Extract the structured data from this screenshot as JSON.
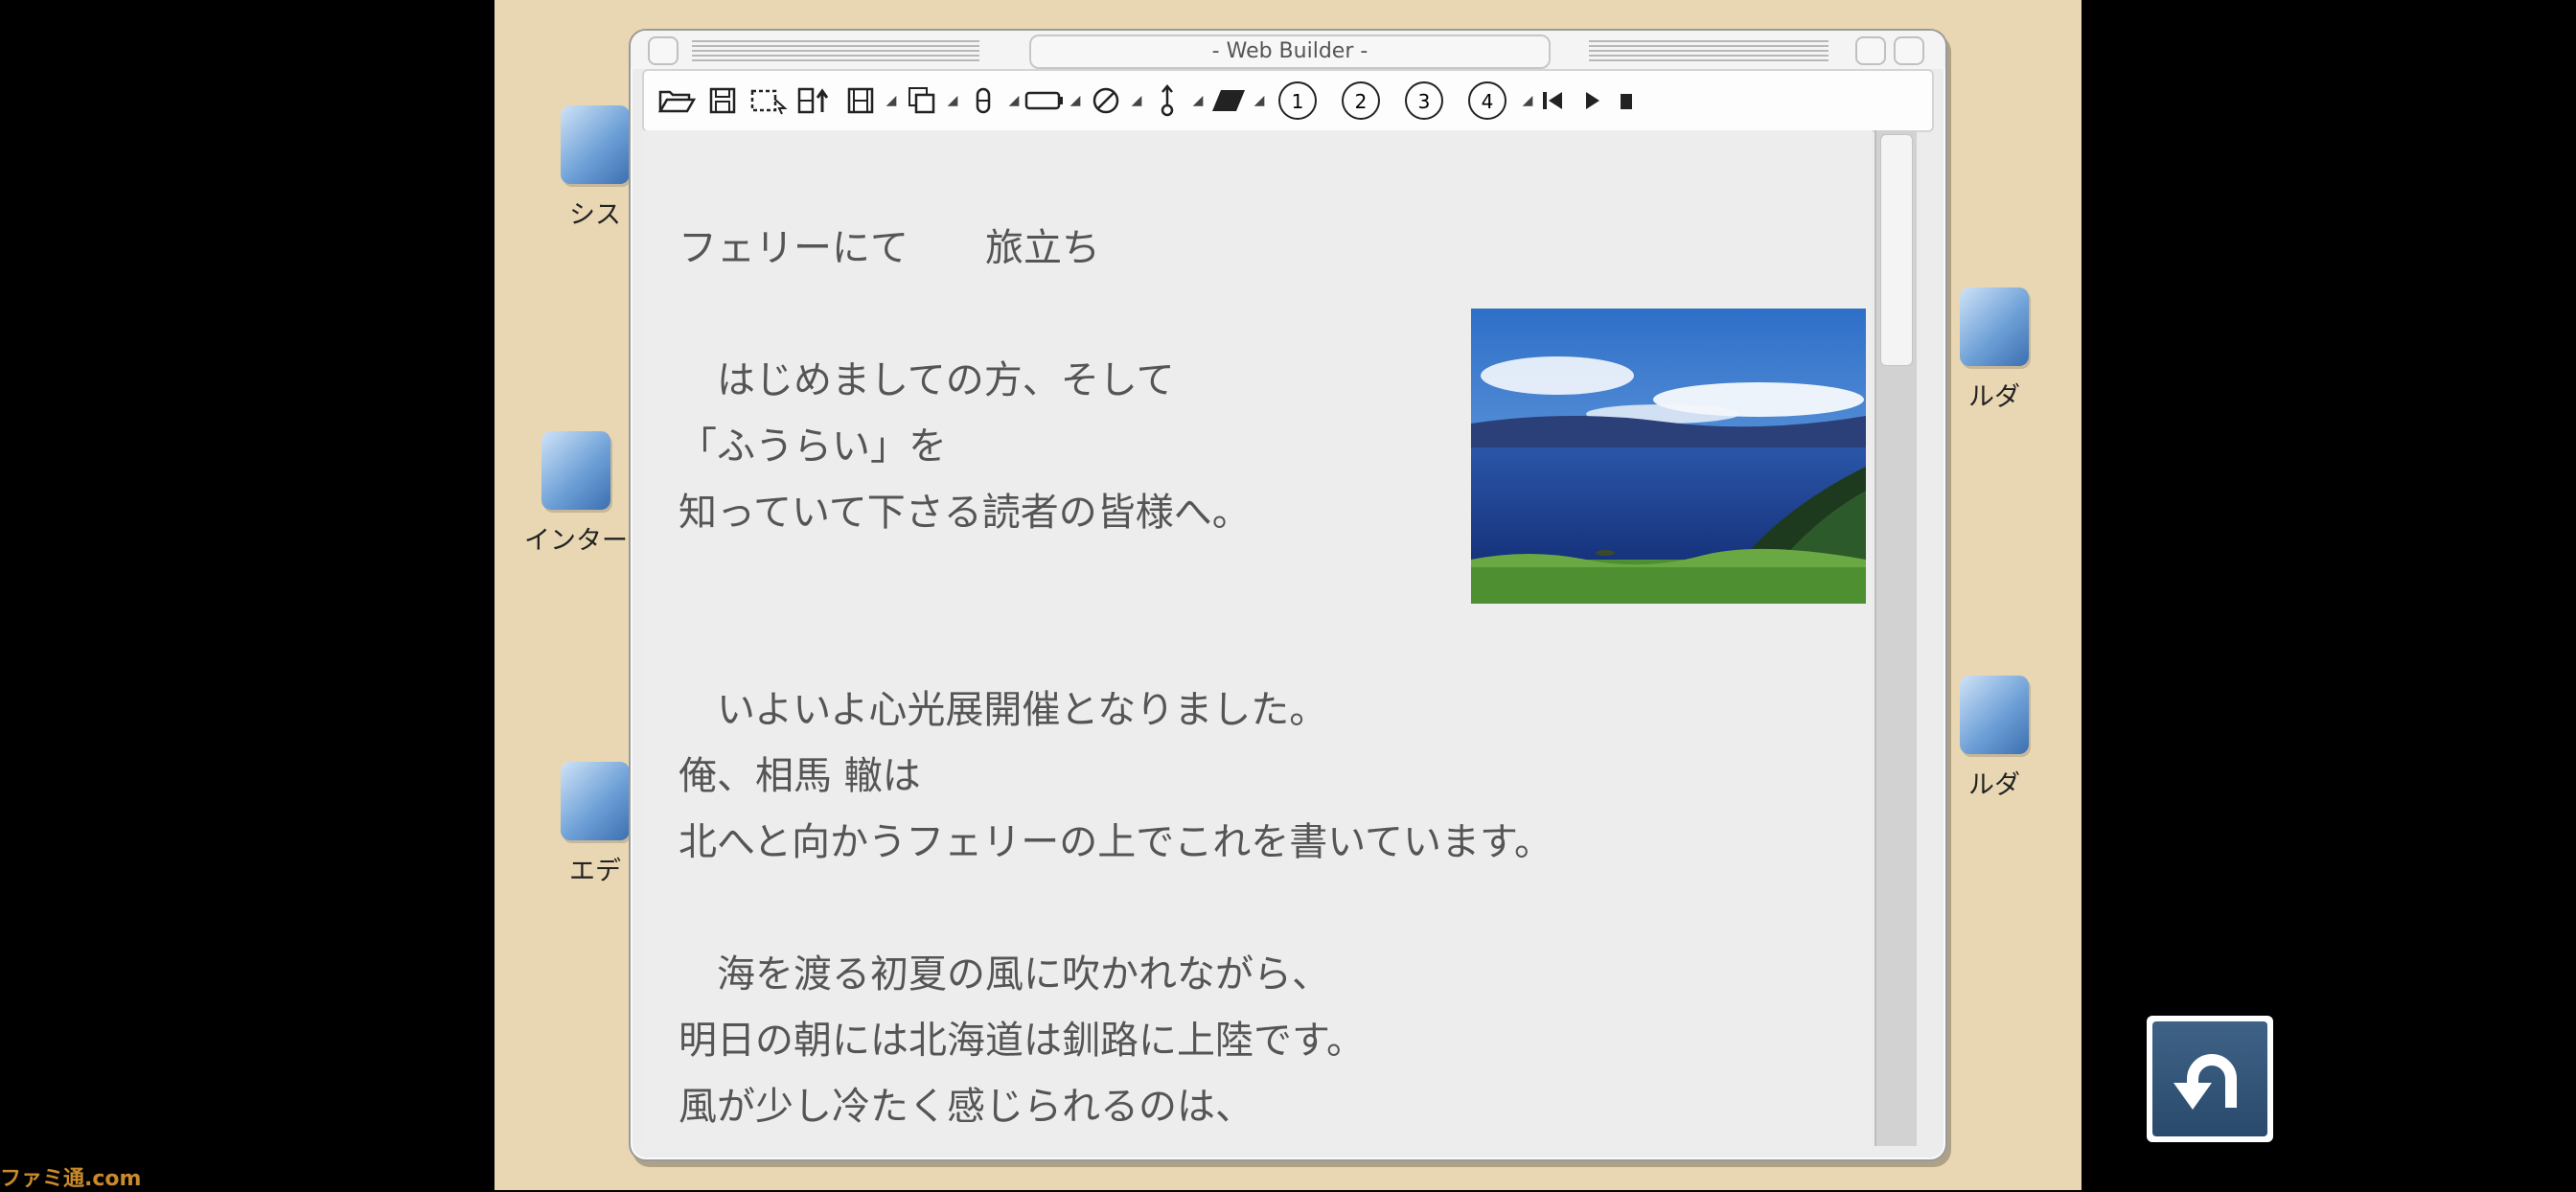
{
  "desktop": {
    "icons": [
      {
        "label": "シス"
      },
      {
        "label": "インター"
      },
      {
        "label": "エデ"
      },
      {
        "label": "ルダ"
      },
      {
        "label": "ルダ"
      }
    ]
  },
  "window": {
    "title": "- Web Builder -",
    "toolbar": {
      "number_buttons": [
        "1",
        "2",
        "3",
        "4"
      ]
    }
  },
  "document": {
    "heading": "フェリーにて　　旅立ち",
    "lines": [
      "　はじめましての方、そして",
      "「ふうらい」を",
      "知っていて下さる読者の皆様へ。",
      "　いよいよ心光展開催となりました。",
      "俺、相馬 轍は",
      "北へと向かうフェリーの上でこれを書いています。",
      "　海を渡る初夏の風に吹かれながら、",
      "明日の朝には北海道は釧路に上陸です。",
      "風が少し冷たく感じられるのは、"
    ]
  },
  "watermark": "ファミ通.com",
  "colors": {
    "desktop_bg": "#e9d7b3",
    "window_bg": "#ececec",
    "text": "#555555",
    "undo_button": "#35587c"
  }
}
